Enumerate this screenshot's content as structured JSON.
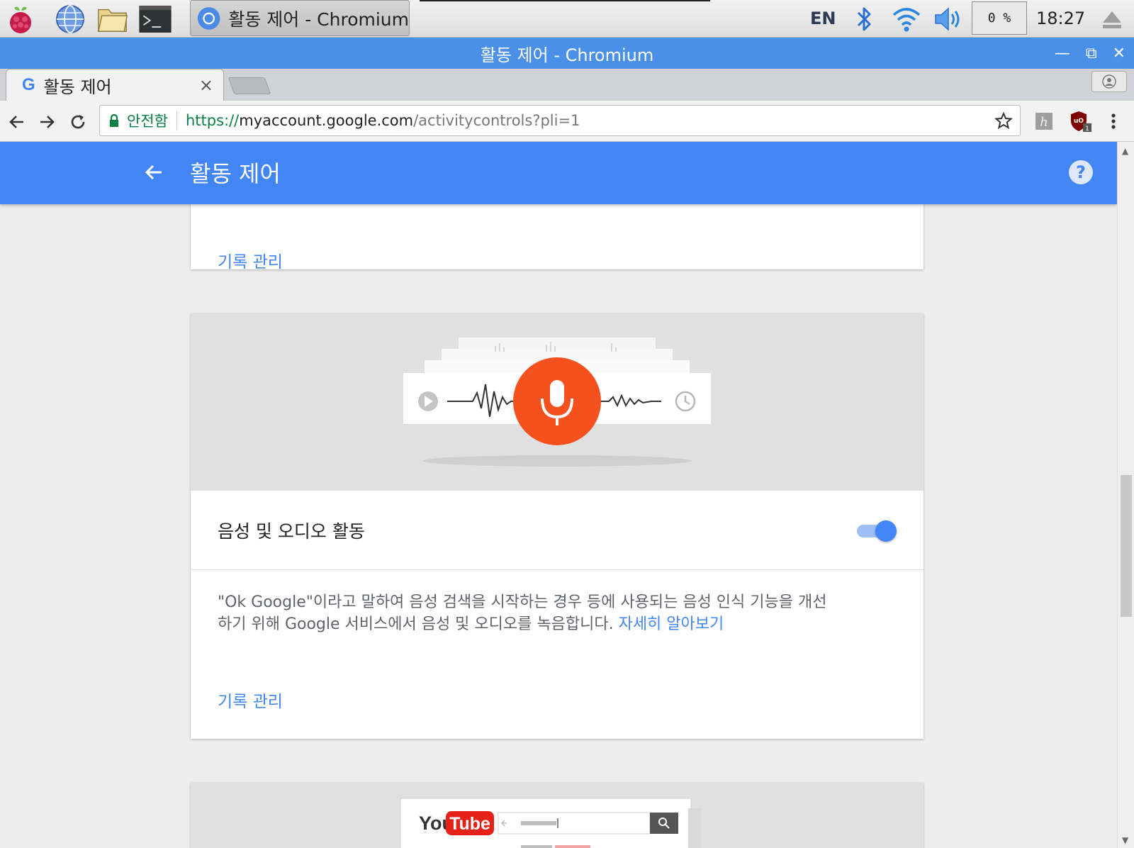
{
  "taskbar": {
    "task_label": "활동 제어 - Chromium",
    "language": "EN",
    "cpu": "0 %",
    "clock": "18:27"
  },
  "window": {
    "title": "활동 제어 - Chromium"
  },
  "tab": {
    "label": "활동 제어",
    "favicon": "G"
  },
  "omnibox": {
    "secure_label": "안전함",
    "scheme": "https://",
    "host": "myaccount.google.com",
    "path": "/activitycontrols?pli=1"
  },
  "extensions": {
    "ublock_badge": "1"
  },
  "appbar": {
    "title": "활동 제어",
    "help": "?"
  },
  "card1": {
    "manage_link": "기록 관리"
  },
  "voice_card": {
    "setting_name": "음성 및 오디오 활동",
    "toggle_on": true,
    "description": "\"Ok Google\"이라고 말하여 음성 검색을 시작하는 경우 등에 사용되는 음성 인식 기능을 개선하기 위해 Google 서비스에서 음성 및 오디오를 녹음합니다.",
    "learn_more": "자세히 알아보기",
    "manage_link": "기록 관리"
  },
  "youtube_card": {
    "logo_you": "You",
    "logo_tube": "Tube"
  },
  "colors": {
    "brand_blue": "#4285f4",
    "titlebar_blue": "#4a90e9",
    "mic_red": "#f4511e"
  }
}
